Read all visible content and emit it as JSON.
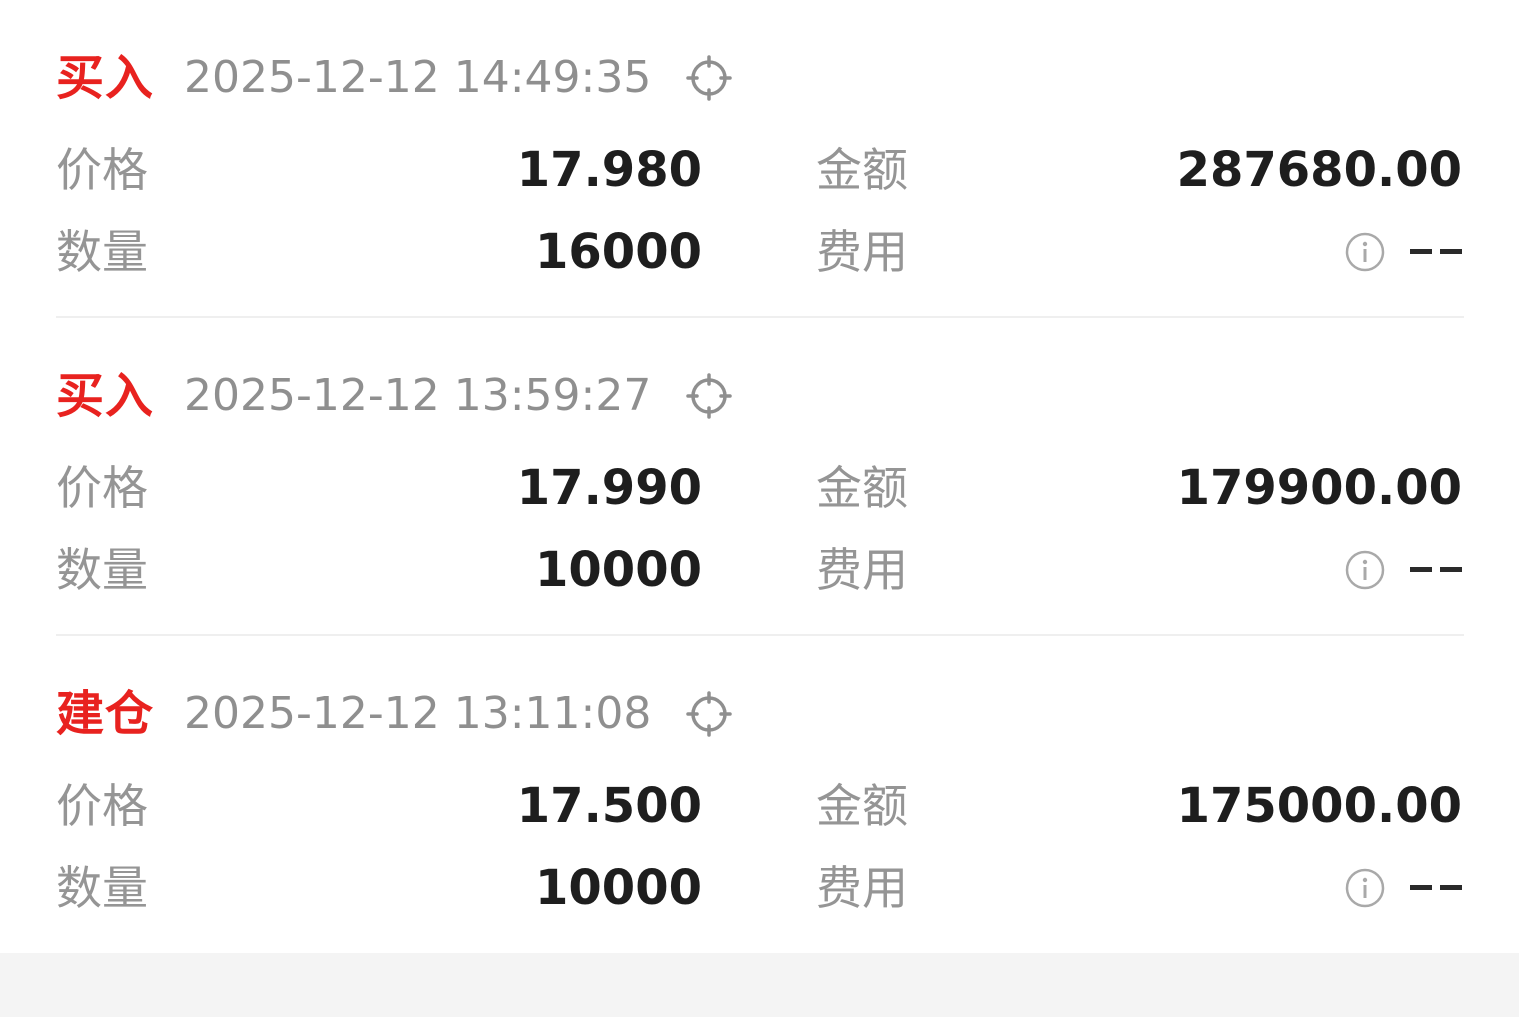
{
  "records": [
    {
      "action": "买入",
      "time": "2025-12-12 14:49:35",
      "price_label": "价格",
      "price": "17.980",
      "amount_label": "金额",
      "amount": "287680.00",
      "qty_label": "数量",
      "qty": "16000",
      "fee_label": "费用",
      "fee": "--"
    },
    {
      "action": "买入",
      "time": "2025-12-12 13:59:27",
      "price_label": "价格",
      "price": "17.990",
      "amount_label": "金额",
      "amount": "179900.00",
      "qty_label": "数量",
      "qty": "10000",
      "fee_label": "费用",
      "fee": "--"
    },
    {
      "action": "建仓",
      "time": "2025-12-12 13:11:08",
      "price_label": "价格",
      "price": "17.500",
      "amount_label": "金额",
      "amount": "175000.00",
      "qty_label": "数量",
      "qty": "10000",
      "fee_label": "费用",
      "fee": "--"
    }
  ],
  "icons": {
    "locate": "crosshair-icon",
    "info": "info-icon"
  },
  "colors": {
    "action": "#e8221f",
    "label": "#959595",
    "value": "#1e1e1e",
    "time": "#8f8f8f",
    "background": "#f4f4f4"
  }
}
